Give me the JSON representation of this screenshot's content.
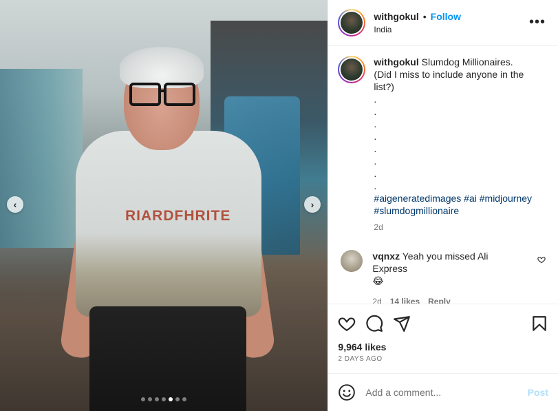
{
  "post": {
    "username": "withgokul",
    "separator": "•",
    "follow_label": "Follow",
    "location": "India",
    "more_icon": "•••"
  },
  "caption": {
    "username": "withgokul",
    "text": "Slumdog Millionaires.",
    "line2": "(Did I miss to include anyone in the list?)",
    "dots": [
      ".",
      ".",
      ".",
      ".",
      ".",
      ".",
      ".",
      "."
    ],
    "hashtags": [
      "#aigeneratedimages",
      "#ai",
      "#midjourney",
      "#slumdogmillionaire"
    ],
    "age": "2d"
  },
  "comment": {
    "username": "vqnxz",
    "text": "Yeah you missed Ali Express",
    "emoji": "😂",
    "age": "2d",
    "likes": "14 likes",
    "reply_label": "Reply"
  },
  "media": {
    "shirt_text": "RIARDFHRITE",
    "prev_icon": "‹",
    "next_icon": "›",
    "slides": 7,
    "active_slide": 5
  },
  "actions": {
    "likes": "9,964 likes",
    "date": "2 DAYS AGO"
  },
  "composer": {
    "placeholder": "Add a comment...",
    "post_label": "Post"
  }
}
